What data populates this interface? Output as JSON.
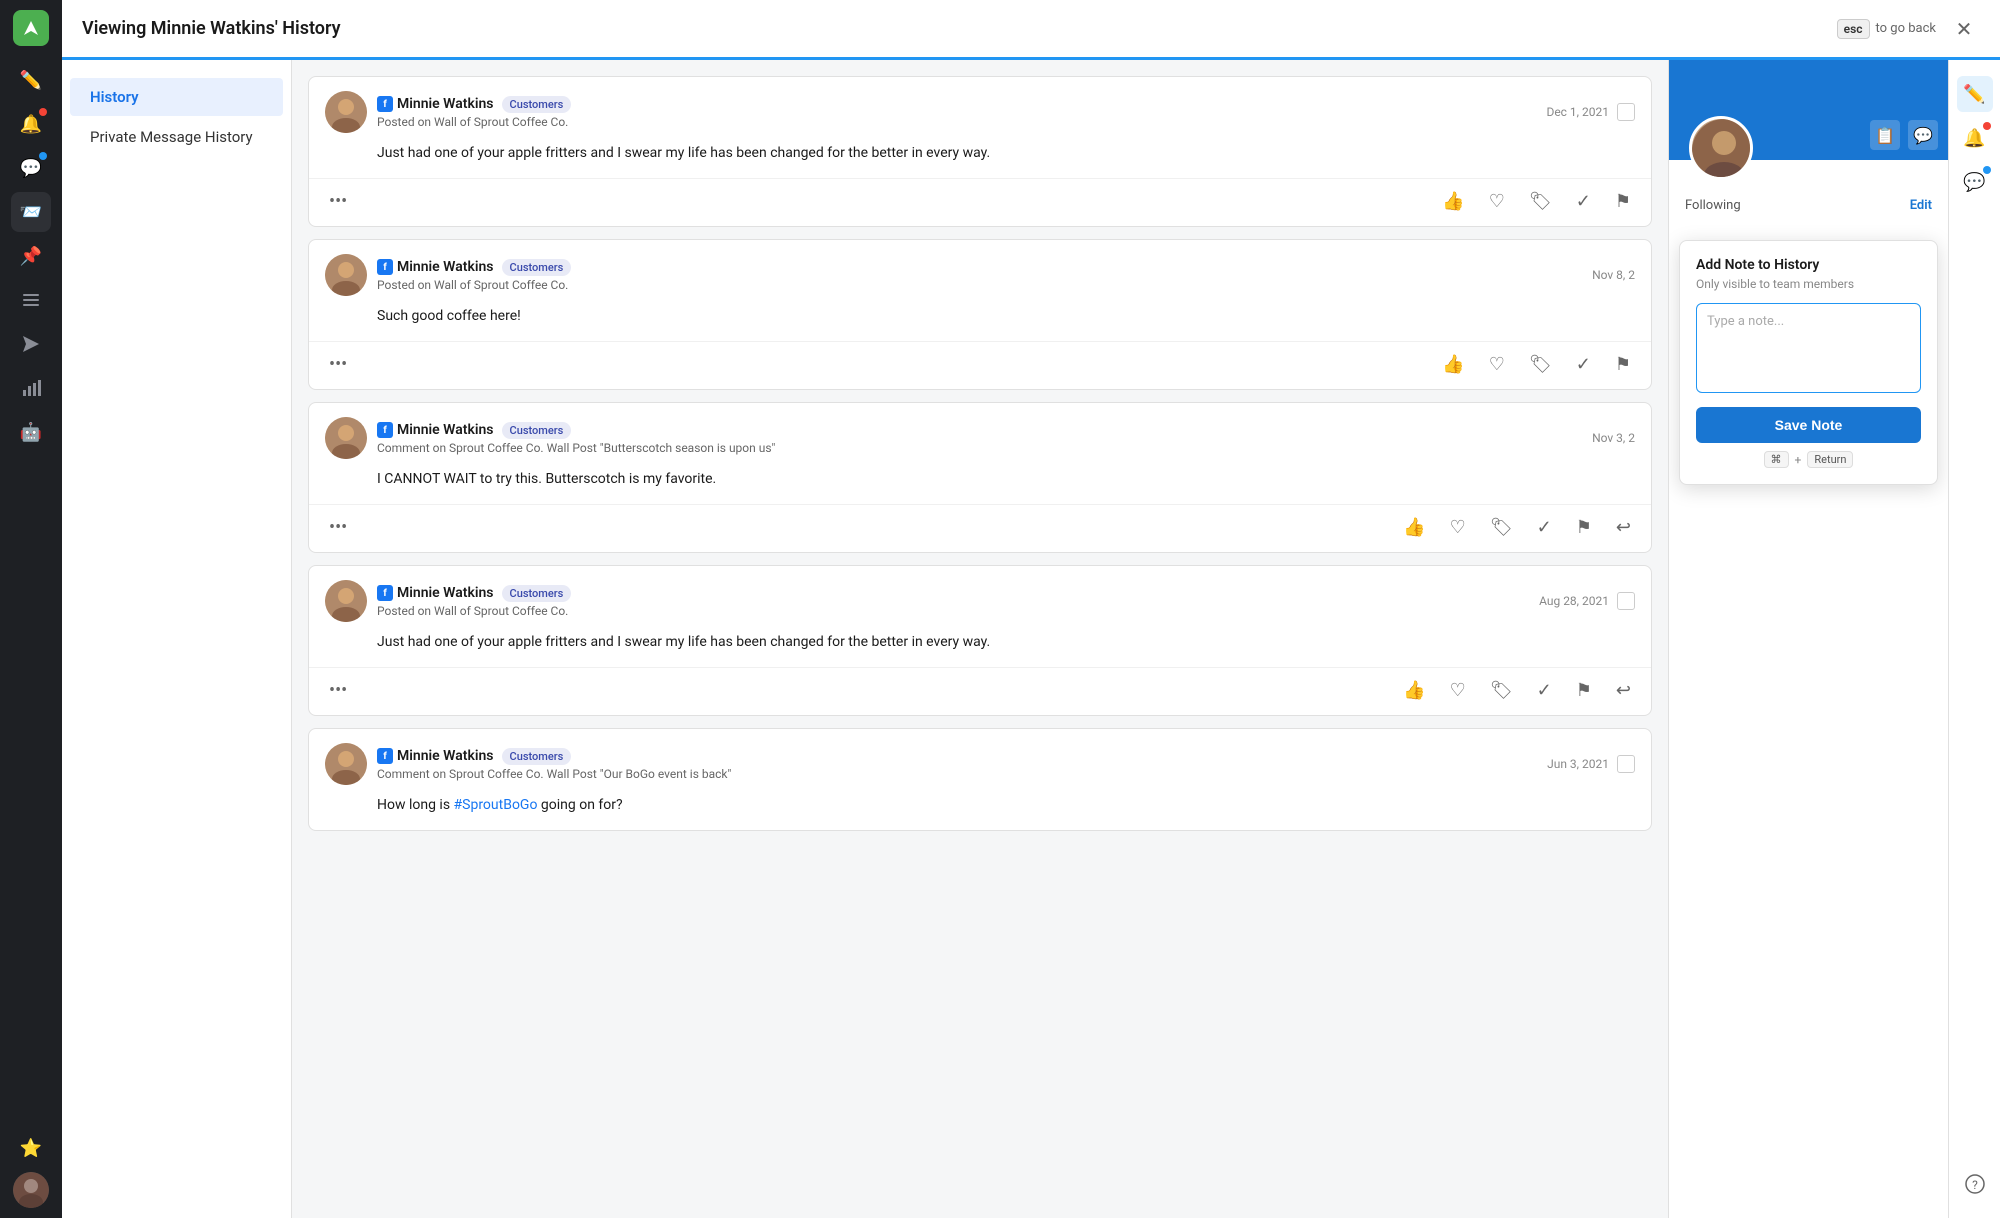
{
  "app": {
    "title": "Viewing Minnie Watkins' History",
    "esc_label": "esc",
    "go_back_label": "to go back"
  },
  "sidebar": {
    "icons": [
      {
        "name": "compose-icon",
        "symbol": "✏",
        "badge": null,
        "active": false
      },
      {
        "name": "notifications-icon",
        "symbol": "🔔",
        "badge": "red",
        "active": false
      },
      {
        "name": "comments-icon",
        "symbol": "💬",
        "badge": "blue",
        "active": false
      },
      {
        "name": "inbox-icon",
        "symbol": "📨",
        "badge": null,
        "active": true
      },
      {
        "name": "pin-icon",
        "symbol": "📌",
        "badge": null,
        "active": false
      },
      {
        "name": "tasks-icon",
        "symbol": "☰",
        "badge": null,
        "active": false
      },
      {
        "name": "send-icon",
        "symbol": "➤",
        "badge": null,
        "active": false
      },
      {
        "name": "analytics-icon",
        "symbol": "📊",
        "badge": null,
        "active": false
      },
      {
        "name": "bot-icon",
        "symbol": "🤖",
        "badge": null,
        "active": false
      },
      {
        "name": "star-icon",
        "symbol": "⭐",
        "badge": null,
        "active": false
      }
    ]
  },
  "left_nav": {
    "items": [
      {
        "label": "History",
        "active": true
      },
      {
        "label": "Private Message History",
        "active": false
      }
    ]
  },
  "posts": [
    {
      "id": "post-1",
      "author": "Minnie Watkins",
      "tag": "Customers",
      "sub": "Posted on Wall of Sprout Coffee Co.",
      "date": "Dec 1, 2021",
      "body": "Just had one of your apple fritters and I swear my life has been changed for the better in every way.",
      "has_checkbox": true
    },
    {
      "id": "post-2",
      "author": "Minnie Watkins",
      "tag": "Customers",
      "sub": "Posted on Wall of Sprout Coffee Co.",
      "date": "Nov 8, 2",
      "body": "Such good coffee here!",
      "has_checkbox": false
    },
    {
      "id": "post-3",
      "author": "Minnie Watkins",
      "tag": "Customers",
      "sub": "Comment on Sprout Coffee Co. Wall Post \"Butterscotch season is upon us\"",
      "date": "Nov 3, 2",
      "body": "I CANNOT WAIT to try this. Butterscotch is my favorite.",
      "has_checkbox": false
    },
    {
      "id": "post-4",
      "author": "Minnie Watkins",
      "tag": "Customers",
      "sub": "Posted on Wall of Sprout Coffee Co.",
      "date": "Aug 28, 2021",
      "body": "Just had one of your apple fritters and I swear my life has been changed for the better in every way.",
      "has_checkbox": true
    },
    {
      "id": "post-5",
      "author": "Minnie Watkins",
      "tag": "Customers",
      "sub": "Comment on Sprout Coffee Co. Wall Post \"Our BoGo event is back\"",
      "date": "Jun 3, 2021",
      "body_prefix": "How long is ",
      "body_hashtag": "#SproutBoGo",
      "body_suffix": " going on for?",
      "has_checkbox": true
    }
  ],
  "add_note": {
    "title": "Add Note to History",
    "subtitle": "Only visible to team members",
    "placeholder": "Type a note...",
    "save_label": "Save Note",
    "shortcut_key": "⌘",
    "shortcut_return": "Return"
  },
  "right_panel": {
    "following_label": "llowing",
    "edit_label": "Edit"
  },
  "right_sidebar_icons": [
    {
      "name": "compose-right-icon",
      "symbol": "✏",
      "active": true,
      "badge": null
    },
    {
      "name": "bell-right-icon",
      "symbol": "🔔",
      "badge": "red",
      "active": false
    },
    {
      "name": "speech-right-icon",
      "symbol": "💬",
      "badge": "blue",
      "active": false
    },
    {
      "name": "help-icon",
      "symbol": "?",
      "badge": null,
      "active": false
    }
  ]
}
